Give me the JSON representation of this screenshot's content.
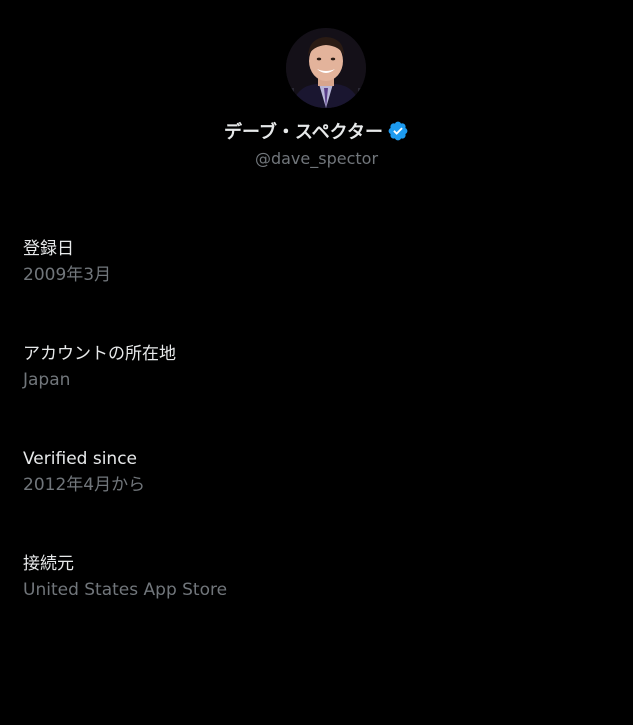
{
  "profile": {
    "avatar_icon": "avatar",
    "display_name": "デーブ・スペクター",
    "verified_icon": "verified-badge-icon",
    "verified_color": "#1d9bf0",
    "handle": "@dave_spector"
  },
  "info": [
    {
      "label": "登録日",
      "value": "2009年3月"
    },
    {
      "label": "アカウントの所在地",
      "value": "Japan"
    },
    {
      "label": "Verified since",
      "value": "2012年4月から"
    },
    {
      "label": "接続元",
      "value": "United States App Store"
    }
  ],
  "colors": {
    "background": "#000000",
    "primary_text": "#e7e9ea",
    "secondary_text": "#71767b"
  }
}
